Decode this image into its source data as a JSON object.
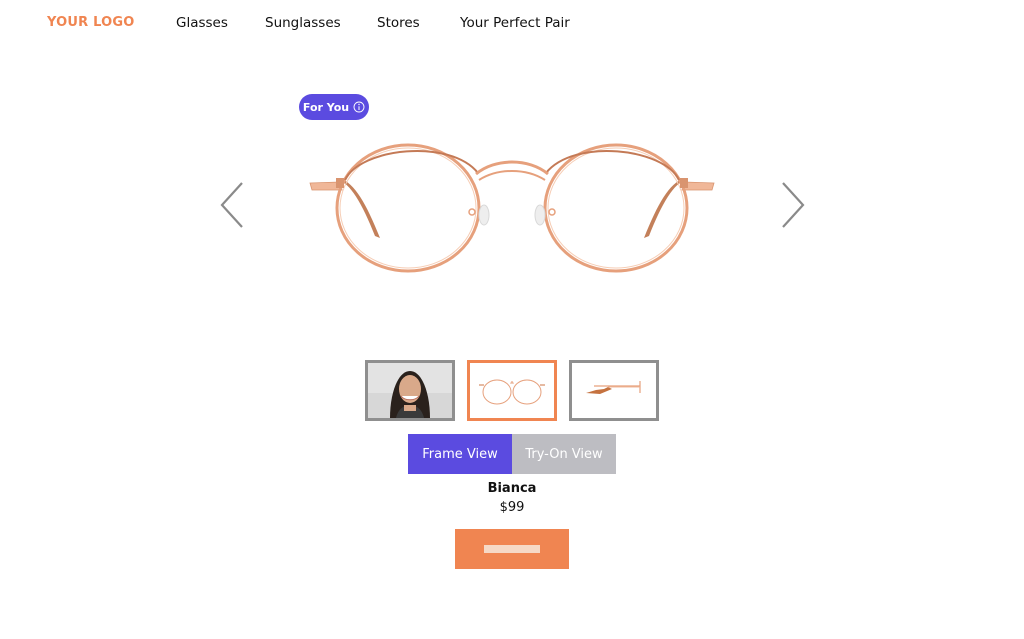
{
  "header": {
    "logo": "YOUR LOGO",
    "nav": [
      {
        "label": "Glasses"
      },
      {
        "label": "Sunglasses"
      },
      {
        "label": "Stores"
      },
      {
        "label": "Your Perfect Pair"
      }
    ]
  },
  "badge": {
    "label": "For You",
    "icon": "info-icon"
  },
  "carousel": {
    "prev_icon": "chevron-left-icon",
    "next_icon": "chevron-right-icon",
    "thumbnails": [
      {
        "name": "model-photo",
        "selected": false
      },
      {
        "name": "front-view",
        "selected": true
      },
      {
        "name": "side-view",
        "selected": false
      }
    ]
  },
  "view_toggle": {
    "frame_label": "Frame View",
    "tryon_label": "Try-On View",
    "active": "frame"
  },
  "product": {
    "name": "Bianca",
    "price": "$99"
  },
  "colors": {
    "brand": "#f08551",
    "accent": "#5b4be0",
    "inactive": "#bdbdc2",
    "frame_gold": "#e8a27e",
    "frame_edge": "#c47a56"
  }
}
